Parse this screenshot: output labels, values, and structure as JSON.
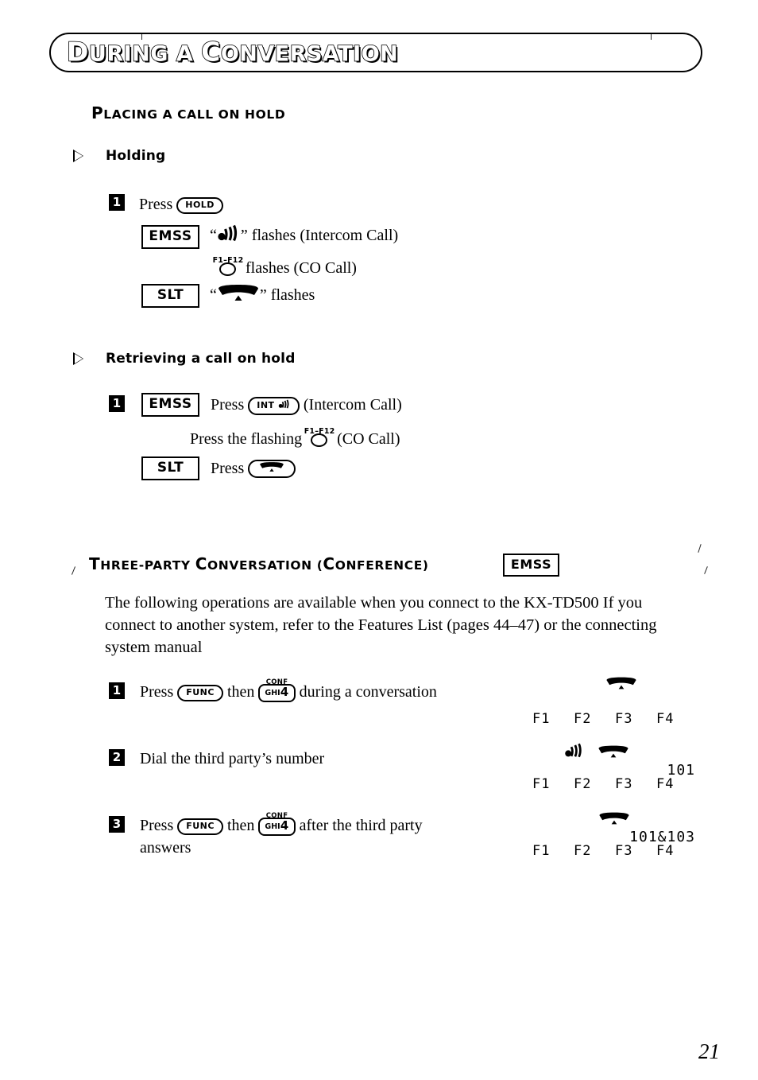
{
  "banner": {
    "title_first": "D",
    "title_rest_1": "URING A ",
    "title_cap_2": "C",
    "title_rest_2": "ONVERSATION",
    "title_full": "DURING A CONVERSATION"
  },
  "section1": {
    "heading_cap": "P",
    "heading_rest": "LACING A CALL ON HOLD",
    "heading_full": "PLACING A CALL ON HOLD",
    "sub1": {
      "title": "Holding",
      "step_number": "1",
      "press_label": "Press",
      "key_hold": "HOLD",
      "mode_emss": "EMSS",
      "mode_slt": "SLT",
      "emss_line_quote_open": "“",
      "emss_line_quote_close": "”",
      "emss_line_text": "flashes (Intercom Call)",
      "co_led_caption": "F1–F12",
      "co_line_text": "flashes (CO Call)",
      "slt_line_text": "flashes"
    },
    "sub2": {
      "title": "Retrieving a call on hold",
      "step_number": "1",
      "mode_emss": "EMSS",
      "mode_slt": "SLT",
      "press_label": "Press",
      "key_int": "INT",
      "intercom_note": "(Intercom Call)",
      "press_flashing_label": "Press the flashing",
      "co_led_caption": "F1–F12",
      "co_note": "(CO Call)",
      "slt_press_label": "Press"
    }
  },
  "section2": {
    "heading_cap": "T",
    "heading_rest_1": "HREE-PARTY ",
    "heading_cap_2": "C",
    "heading_rest_2": "ONVERSATION (",
    "heading_cap_3": "C",
    "heading_rest_3": "ONFERENCE)",
    "heading_full": "THREE-PARTY CONVERSATION (CONFERENCE)",
    "mode_emss": "EMSS",
    "paragraph": "The following operations are available when you connect to the KX-TD500  If you connect to another system, refer to the Features List (pages 44–47) or the connecting system manual",
    "steps": [
      {
        "number": "1",
        "text_before": "Press",
        "key_func": "FUNC",
        "text_mid": "then",
        "key_conf_caption": "CONF",
        "key_conf_letters": "GHI",
        "key_conf_digit": "4",
        "text_after": "during a conversation",
        "text_after2": ""
      },
      {
        "number": "2",
        "text_before": "Dial the third party’s number",
        "key_func": "",
        "text_mid": "",
        "key_conf_caption": "",
        "key_conf_letters": "",
        "key_conf_digit": "",
        "text_after": "",
        "text_after2": ""
      },
      {
        "number": "3",
        "text_before": "Press",
        "key_func": "FUNC",
        "text_mid": "then",
        "key_conf_caption": "CONF",
        "key_conf_letters": "GHI",
        "key_conf_digit": "4",
        "text_after": "after the third party",
        "text_after2": "answers"
      }
    ],
    "panels": [
      {
        "lcd_number": "",
        "fkeys": [
          "F1",
          "F2",
          "F3",
          "F4"
        ]
      },
      {
        "lcd_number": "101",
        "fkeys": [
          "F1",
          "F2",
          "F3",
          "F4"
        ]
      },
      {
        "lcd_number": "101&103",
        "fkeys": [
          "F1",
          "F2",
          "F3",
          "F4"
        ]
      }
    ]
  },
  "footer": {
    "page_number": "21"
  },
  "icons": {
    "intercom": "intercom-signal-icon",
    "handset": "handset-icon",
    "led": "led-circle-icon",
    "triangle_bullet": "triangle-bullet-icon"
  }
}
